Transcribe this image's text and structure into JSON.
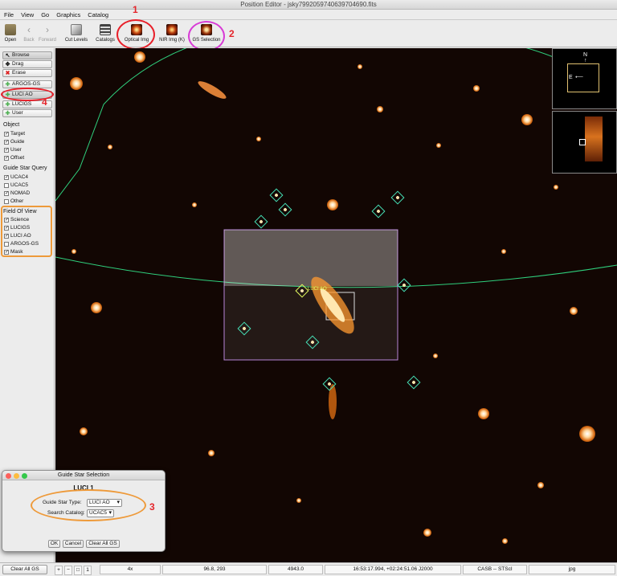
{
  "window": {
    "title": "Position Editor - jsky7992059740639704690.fits"
  },
  "menu": [
    "File",
    "View",
    "Go",
    "Graphics",
    "Catalog"
  ],
  "toolbar": {
    "open": "Open",
    "back": "Back",
    "forward": "Forward",
    "cut_levels": "Cut Levels",
    "catalogs": "Catalogs",
    "optical": "Optical Img",
    "nir": "NIR Img (K)",
    "gs_selection": "GS Selection"
  },
  "callouts": [
    "1",
    "2",
    "3",
    "4"
  ],
  "tools": {
    "browse": "Browse",
    "drag": "Drag",
    "erase": "Erase",
    "argos_gs": "ARGOS-GS",
    "luci_ao": "LUCI AO",
    "lucigs": "LUCIGS",
    "user": "User"
  },
  "object": {
    "title": "Object",
    "items": [
      "Target",
      "Guide",
      "User",
      "Offset"
    ]
  },
  "gsq": {
    "title": "Guide Star Query",
    "items": [
      "UCAC4",
      "UCAC5",
      "NOMAD",
      "Other"
    ],
    "checked": [
      true,
      false,
      true,
      false
    ]
  },
  "fov": {
    "title": "Field Of View",
    "items": [
      "Science",
      "LUCIGS",
      "LUCI AO",
      "ARGOS-GS",
      "Mask"
    ],
    "checked": [
      true,
      true,
      true,
      false,
      true
    ]
  },
  "image": {
    "label": "LUCI AO",
    "compass_n": "N",
    "compass_e": "E"
  },
  "dialog": {
    "title": "Guide Star Selection",
    "heading": "LUCI 1",
    "type_label": "Guide Star Type:",
    "type_value": "LUCI AO",
    "catalog_label": "Search Catalog:",
    "catalog_value": "UCAC5",
    "ok": "OK",
    "cancel": "Cancel",
    "clear": "Clear All GS"
  },
  "status": {
    "clear_all": "Clear All GS",
    "zoom": "4x",
    "pixel": "96.8, 293",
    "value": "4943.0",
    "coords": "16:53:17.994, +02:24:51.06 J2000",
    "credit": "CASB -- STScI",
    "format": "jpg"
  },
  "colors": {
    "callout_red": "#e4252b",
    "callout_magenta": "#d83cd6",
    "callout_orange": "#ee9a3a",
    "fov_green": "#2fd07d"
  }
}
